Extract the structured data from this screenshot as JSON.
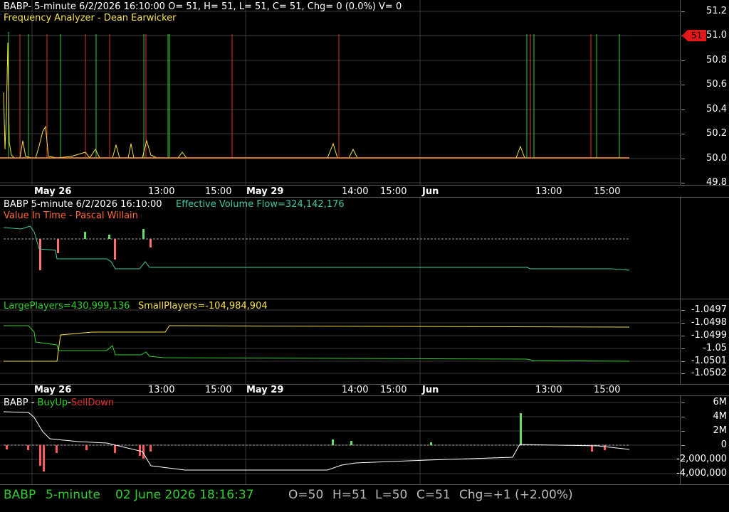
{
  "colors": {
    "green": "#33cc33",
    "red": "#e03030",
    "orange": "#ff8c3a",
    "yellow": "#f5e050",
    "teal": "#40c8a8",
    "white": "#ffffff",
    "grid": "#3a3a3a"
  },
  "panel1": {
    "header": "BABP- 5-minute 6/2/2026 16:10:00 O= 51, H= 51, L= 51, C= 51, Chg= 0 (0.0%) V= 0",
    "indicator": "Frequency Analyzer - Dean Earwicker",
    "y_ticks": [
      "51.2",
      "51.0",
      "50.8",
      "50.6",
      "50.4",
      "50.2",
      "50.0",
      "49.8"
    ],
    "price_marker": "51"
  },
  "date_axis_1": {
    "labels": [
      "May 26",
      "13:00",
      "15:00",
      "May 29",
      "14:00",
      "15:00",
      "Jun",
      "13:00",
      "15:00"
    ]
  },
  "panel2": {
    "header_left": "BABP 5-minute  6/2/2026 16:10:00",
    "header_right": "Effective Volume Flow=324,142,176",
    "indicator": "Value In Time - Pascal Willain"
  },
  "panel3": {
    "large": "LargePlayers=430,999,136",
    "small": "SmallPlayers=-104,984,904",
    "y_ticks": [
      "-1.0497",
      "-1.0498",
      "-1.0499",
      "-1.05",
      "-1.0501",
      "-1.0502"
    ]
  },
  "date_axis_2": {
    "labels": [
      "May 26",
      "13:00",
      "15:00",
      "May 29",
      "14:00",
      "15:00",
      "Jun",
      "13:00",
      "15:00"
    ]
  },
  "panel4": {
    "ticker": "BABP - ",
    "buy": "BuyUp",
    "dash": "-",
    "sell": "SellDown",
    "y_ticks": [
      "6M",
      "4M",
      "2M",
      "0",
      "-2,000,000",
      "-4,000,000"
    ]
  },
  "status": {
    "ticker": "BABP",
    "interval": "5-minute",
    "datetime": "02 June 2026 18:16:37",
    "open": "O=50",
    "high": "H=51",
    "low": "L=50",
    "close": "C=51",
    "change": "Chg=+1 (+2.00%)"
  }
}
